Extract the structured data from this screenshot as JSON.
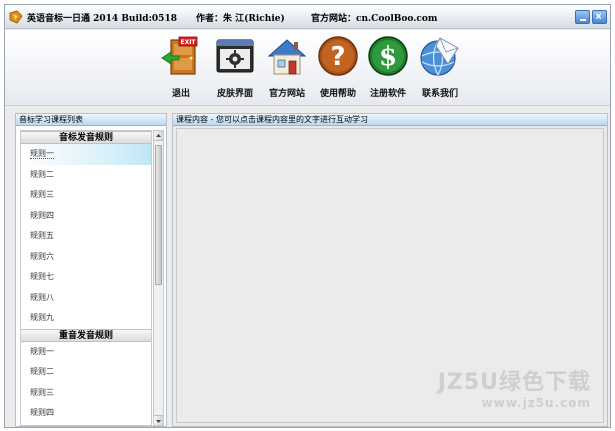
{
  "titlebar": {
    "app_name": "英语音标一日通 2014 Build:0518",
    "author": "作者：朱 江(Richie)",
    "website": "官方网站：cn.CoolBoo.com"
  },
  "toolbar": {
    "buttons": [
      {
        "label": "退出",
        "icon": "exit-door-icon"
      },
      {
        "label": "皮肤界面",
        "icon": "skin-window-icon"
      },
      {
        "label": "官方网站",
        "icon": "home-icon"
      },
      {
        "label": "使用帮助",
        "icon": "help-question-icon"
      },
      {
        "label": "注册软件",
        "icon": "dollar-icon"
      },
      {
        "label": "联系我们",
        "icon": "globe-mail-icon"
      }
    ]
  },
  "left_panel": {
    "title": "音标学习课程列表",
    "sections": [
      {
        "header": "音标发音规则",
        "items": [
          "规则一",
          "规则二",
          "规则三",
          "规则四",
          "规则五",
          "规则六",
          "规则七",
          "规则八",
          "规则九"
        ]
      },
      {
        "header": "重音发音规则",
        "items": [
          "规则一",
          "规则二",
          "规则三",
          "规则四"
        ]
      }
    ]
  },
  "right_panel": {
    "title": "课程内容 - 您可以点击课程内容里的文字进行互动学习"
  },
  "watermark": {
    "line1": "JZ5U绿色下载",
    "line2": "www.jz5u.com"
  },
  "colors": {
    "panel_header": "#b9d8f2",
    "selected_item": "#bfe6f6",
    "window_bg": "#ececec"
  }
}
